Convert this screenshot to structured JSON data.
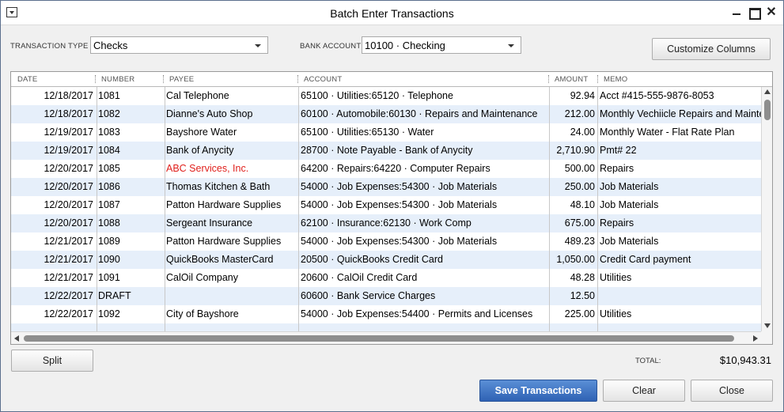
{
  "window": {
    "title": "Batch Enter Transactions",
    "close_glyph": "✕"
  },
  "transaction_type": {
    "label": "TRANSACTION TYPE",
    "value": "Checks"
  },
  "bank_account": {
    "label": "BANK ACCOUNT",
    "value": "10100 · Checking"
  },
  "customize_button": "Customize Columns",
  "columns": [
    "DATE",
    "NUMBER",
    "PAYEE",
    "ACCOUNT",
    "AMOUNT",
    "MEMO"
  ],
  "rows": [
    {
      "date": "12/18/2017",
      "number": "1081",
      "payee": "Cal Telephone",
      "account": "65100 · Utilities:65120 · Telephone",
      "amount": "92.94",
      "memo": "Acct #415-555-9876-8053"
    },
    {
      "date": "12/18/2017",
      "number": "1082",
      "payee": "Dianne's Auto Shop",
      "account": "60100 · Automobile:60130 · Repairs and Maintenance",
      "amount": "212.00",
      "memo": "Monthly Vechiicle Repairs and Mainte"
    },
    {
      "date": "12/19/2017",
      "number": "1083",
      "payee": "Bayshore Water",
      "account": "65100 · Utilities:65130 · Water",
      "amount": "24.00",
      "memo": "Monthly Water - Flat Rate Plan"
    },
    {
      "date": "12/19/2017",
      "number": "1084",
      "payee": "Bank of Anycity",
      "account": "28700 · Note Payable - Bank of Anycity",
      "amount": "2,710.90",
      "memo": "Pmt# 22"
    },
    {
      "date": "12/20/2017",
      "number": "1085",
      "payee": "ABC Services, Inc.",
      "payee_color": "#e0201c",
      "account": "64200 · Repairs:64220 · Computer Repairs",
      "amount": "500.00",
      "memo": "Repairs"
    },
    {
      "date": "12/20/2017",
      "number": "1086",
      "payee": "Thomas Kitchen & Bath",
      "account": "54000 · Job Expenses:54300 · Job Materials",
      "amount": "250.00",
      "memo": "Job Materials"
    },
    {
      "date": "12/20/2017",
      "number": "1087",
      "payee": "Patton Hardware Supplies",
      "account": "54000 · Job Expenses:54300 · Job Materials",
      "amount": "48.10",
      "memo": "Job Materials"
    },
    {
      "date": "12/20/2017",
      "number": "1088",
      "payee": "Sergeant Insurance",
      "account": "62100 · Insurance:62130 · Work Comp",
      "amount": "675.00",
      "memo": "Repairs"
    },
    {
      "date": "12/21/2017",
      "number": "1089",
      "payee": "Patton Hardware Supplies",
      "account": "54000 · Job Expenses:54300 · Job Materials",
      "amount": "489.23",
      "memo": "Job Materials"
    },
    {
      "date": "12/21/2017",
      "number": "1090",
      "payee": "QuickBooks MasterCard",
      "account": "20500 · QuickBooks Credit Card",
      "amount": "1,050.00",
      "memo": "Credit Card payment"
    },
    {
      "date": "12/21/2017",
      "number": "1091",
      "payee": "CalOil Company",
      "account": "20600 · CalOil Credit Card",
      "amount": "48.28",
      "memo": "Utilities"
    },
    {
      "date": "12/22/2017",
      "number": "DRAFT",
      "payee": "",
      "account": "60600 · Bank Service Charges",
      "amount": "12.50",
      "memo": ""
    },
    {
      "date": "12/22/2017",
      "number": "1092",
      "payee": "City of Bayshore",
      "account": "54000 · Job Expenses:54400 · Permits and Licenses",
      "amount": "225.00",
      "memo": "Utilities"
    }
  ],
  "total": {
    "label": "TOTAL:",
    "value": "$10,943.31"
  },
  "buttons": {
    "split": "Split",
    "save": "Save Transactions",
    "clear": "Clear",
    "close": "Close"
  },
  "colors": {
    "accent": "#2f62b4",
    "row_alt": "#e6effa",
    "payee_alert": "#e0201c"
  }
}
